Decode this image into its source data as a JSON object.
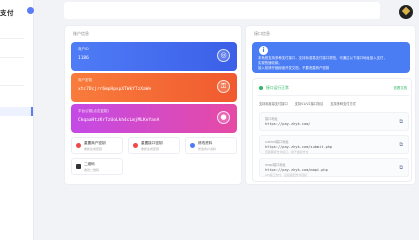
{
  "brand": "支付",
  "account": {
    "section_title": "账户信息",
    "merchant_id": {
      "label": "商户ID",
      "value": "1186"
    },
    "merchant_key": {
      "label": "商户密钥",
      "value": "xtc7Dcjrr6mpHpxpXTWkYTzXaWe"
    },
    "platform_pubkey": {
      "label": "平台公钥(点击复制)",
      "value": "CkqaaHtzKrTzUoLkh4cLmjMLKeYanA"
    },
    "icon_id": "id-icon",
    "icon_key": "key-icon",
    "icon_pubkey": "lock-icon"
  },
  "actions": [
    {
      "title": "重置商户密钥",
      "desc": "重新生成密钥",
      "color": "#f04848"
    },
    {
      "title": "重置接口密钥",
      "desc": "重新生成密钥",
      "color": "#f04848"
    },
    {
      "title": "修改资料",
      "desc": "修改商户资料",
      "color": "#4a7cf3"
    },
    {
      "title": "二维码",
      "desc": "收款二维码",
      "color": "#333333"
    }
  ],
  "api": {
    "section_title": "接口信息",
    "notice_title": "",
    "notice_text_1": "本系统支持多种支付接口，支持标准易支付接口规范，可通过以下接口地址接入支付，",
    "notice_text_2": "实现快速收款。",
    "notice_text_3": "接入前请仔细阅读开发文档，不要泄露商户密钥",
    "status_text": "接口运行正常",
    "status_right": "查看文档",
    "checks": [
      "支持标准易支付接口",
      "支持V1/V2接口协议",
      "支持多种支付方式"
    ],
    "endpoints": [
      {
        "label": "接口地址",
        "url": "https://pay.zhyk.com/",
        "desc": ""
      },
      {
        "label": "submit接口地址",
        "url": "https://pay.zhyk.com/submit.php",
        "desc": "页面跳转支付接口，用于发起支付"
      },
      {
        "label": "mapi接口地址",
        "url": "https://pay.zhyk.com/mapi.php",
        "desc": "API接口支付，直接返回支付链接"
      }
    ],
    "copy_icon": "link-icon"
  },
  "colors": {
    "accent": "#4a7cf3",
    "green": "#2fb866",
    "orange": "#f05a2f",
    "purple": "#c44ae6"
  }
}
